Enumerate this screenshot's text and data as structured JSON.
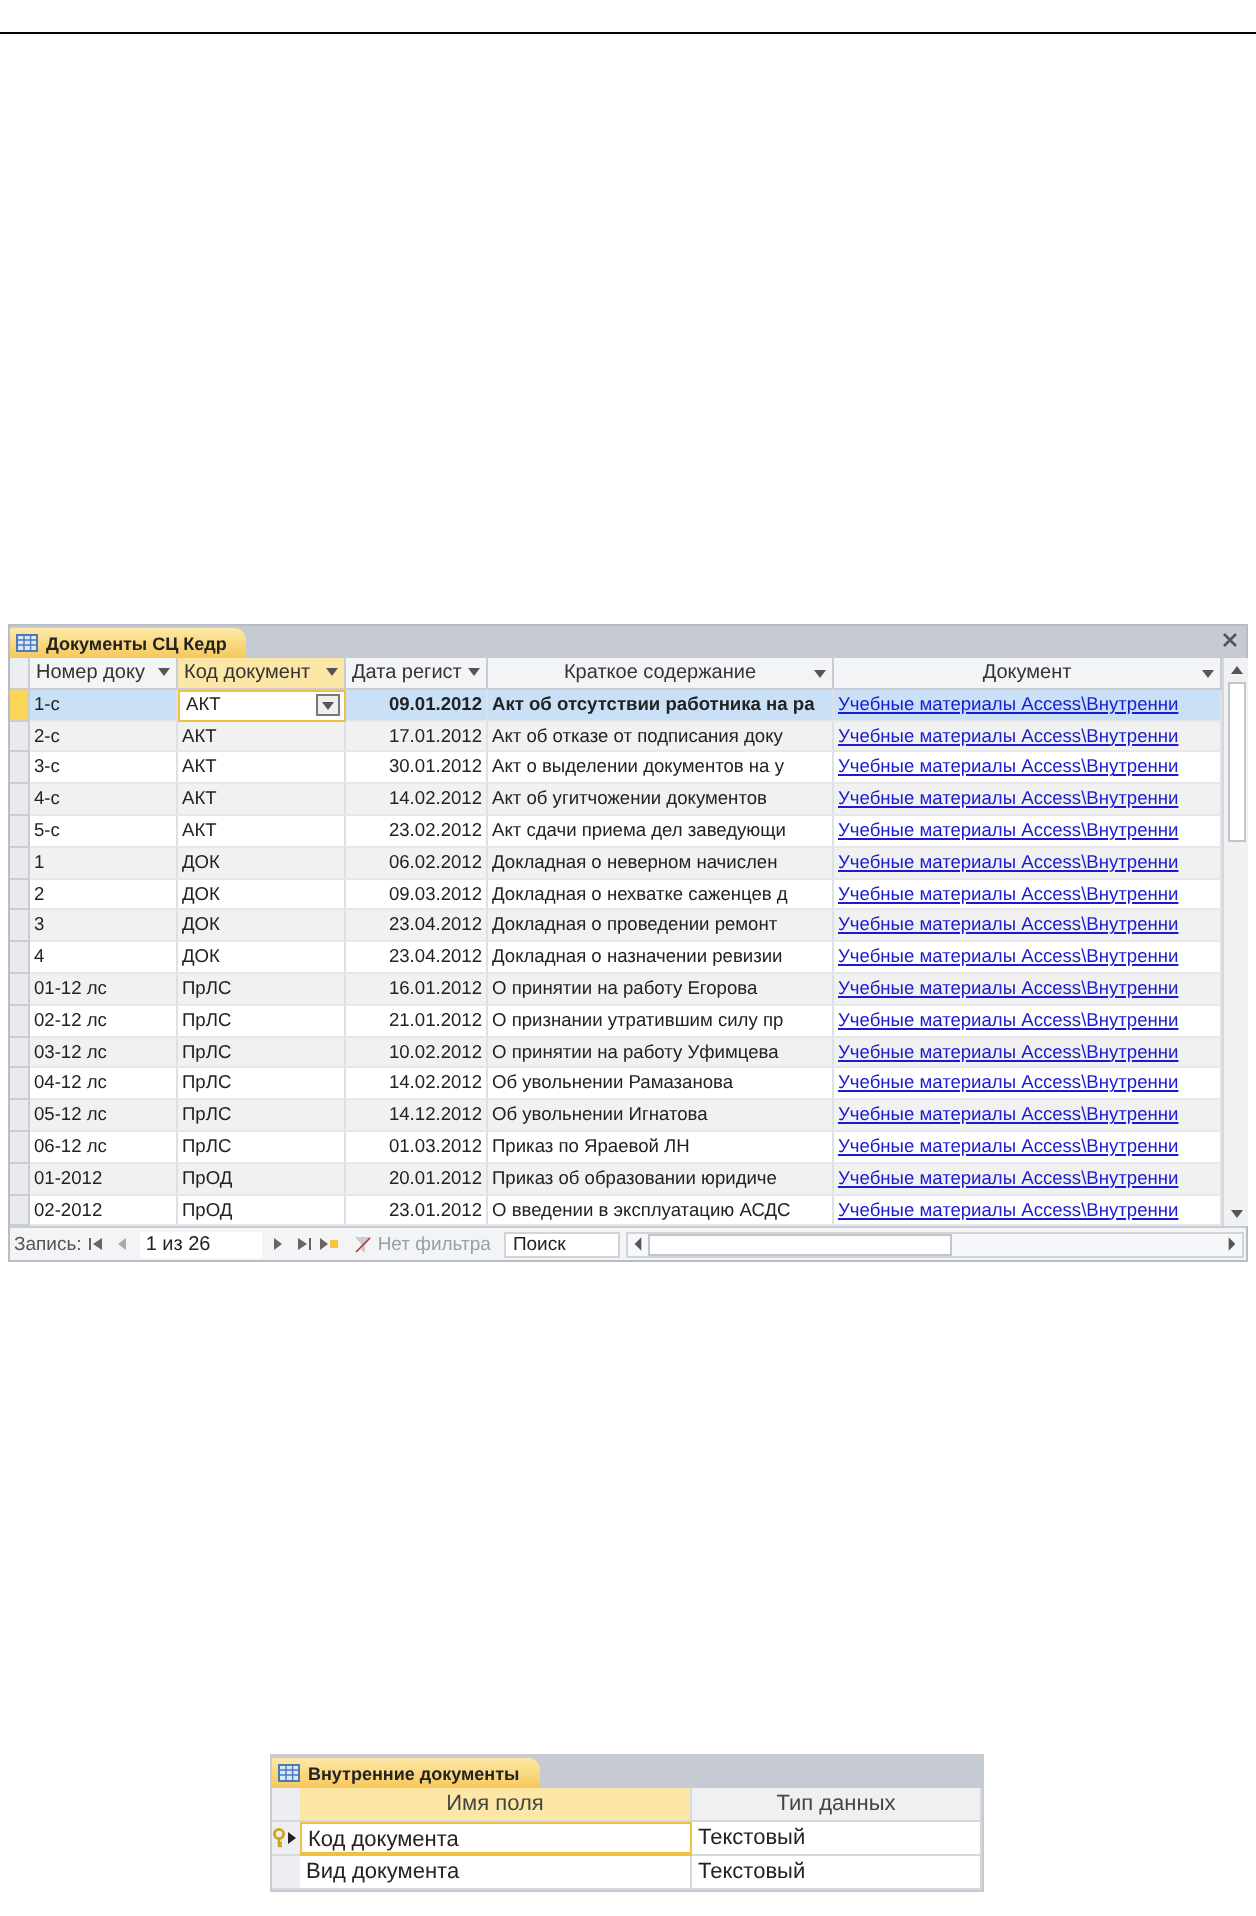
{
  "datasheet": {
    "title": "Документы СЦ Кедр",
    "columns": [
      "Номер доку",
      "Код документ",
      "Дата регист",
      "Краткое содержание",
      "Документ"
    ],
    "rows": [
      {
        "selected": true,
        "cells": [
          "1-с",
          "АКТ",
          "09.01.2012",
          "Акт об отсутствии работника на ра",
          "Учебные материалы Access\\Внутренни"
        ]
      },
      {
        "selected": false,
        "cells": [
          "2-с",
          "АКТ",
          "17.01.2012",
          "Акт об отказе от подписания доку",
          "Учебные материалы Access\\Внутренни"
        ]
      },
      {
        "selected": false,
        "cells": [
          "3-с",
          "АКТ",
          "30.01.2012",
          "Акт о выделении документов на у",
          "Учебные материалы Access\\Внутренни"
        ]
      },
      {
        "selected": false,
        "cells": [
          "4-с",
          "АКТ",
          "14.02.2012",
          "Акт об угитчожении документов",
          "Учебные материалы Access\\Внутренни"
        ]
      },
      {
        "selected": false,
        "cells": [
          "5-с",
          "АКТ",
          "23.02.2012",
          "Акт сдачи приема дел заведующи",
          "Учебные материалы Access\\Внутренни"
        ]
      },
      {
        "selected": false,
        "cells": [
          "1",
          "ДОК",
          "06.02.2012",
          "Докладная о неверном начислен",
          "Учебные материалы Access\\Внутренни"
        ]
      },
      {
        "selected": false,
        "cells": [
          "2",
          "ДОК",
          "09.03.2012",
          "Докладная о нехватке саженцев д",
          "Учебные материалы Access\\Внутренни"
        ]
      },
      {
        "selected": false,
        "cells": [
          "3",
          "ДОК",
          "23.04.2012",
          "Докладная о проведении ремонт",
          "Учебные материалы Access\\Внутренни"
        ]
      },
      {
        "selected": false,
        "cells": [
          "4",
          "ДОК",
          "23.04.2012",
          "Докладная о назначении ревизии",
          "Учебные материалы Access\\Внутренни"
        ]
      },
      {
        "selected": false,
        "cells": [
          "01-12 лс",
          "ПрЛС",
          "16.01.2012",
          "О принятии на работу Егорова",
          "Учебные материалы Access\\Внутренни"
        ]
      },
      {
        "selected": false,
        "cells": [
          "02-12 лс",
          "ПрЛС",
          "21.01.2012",
          "О признании утратившим силу пр",
          "Учебные материалы Access\\Внутренни"
        ]
      },
      {
        "selected": false,
        "cells": [
          "03-12 лс",
          "ПрЛС",
          "10.02.2012",
          "О принятии на работу Уфимцева",
          "Учебные материалы Access\\Внутренни"
        ]
      },
      {
        "selected": false,
        "cells": [
          "04-12 лс",
          "ПрЛС",
          "14.02.2012",
          "Об увольнении Рамазанова",
          "Учебные материалы Access\\Внутренни"
        ]
      },
      {
        "selected": false,
        "cells": [
          "05-12 лс",
          "ПрЛС",
          "14.12.2012",
          "Об увольнении Игнатова",
          "Учебные материалы Access\\Внутренни"
        ]
      },
      {
        "selected": false,
        "cells": [
          "06-12 лс",
          "ПрЛС",
          "01.03.2012",
          "Приказ по Яраевой ЛН",
          "Учебные материалы Access\\Внутренни"
        ]
      },
      {
        "selected": false,
        "cells": [
          "01-2012",
          "ПрОД",
          "20.01.2012",
          "Приказ об образовании юридиче",
          "Учебные материалы Access\\Внутренни"
        ]
      },
      {
        "selected": false,
        "cells": [
          "02-2012",
          "ПрОД",
          "23.01.2012",
          "О введении в эксплуатацию АСДС",
          "Учебные материалы Access\\Внутренни"
        ]
      }
    ],
    "navigation": {
      "label": "Запись:",
      "position": "1 из 26",
      "filter": "Нет фильтра",
      "search": {
        "placeholder": "Поиск"
      }
    }
  },
  "design_view": {
    "title": "Внутренние документы",
    "columns": [
      "Имя поля",
      "Тип данных"
    ],
    "rows": [
      {
        "selected": true,
        "primary_key": true,
        "cells": [
          "Код документа",
          "Текстовый"
        ]
      },
      {
        "selected": false,
        "primary_key": false,
        "cells": [
          "Вид документа",
          "Текстовый"
        ]
      }
    ]
  }
}
